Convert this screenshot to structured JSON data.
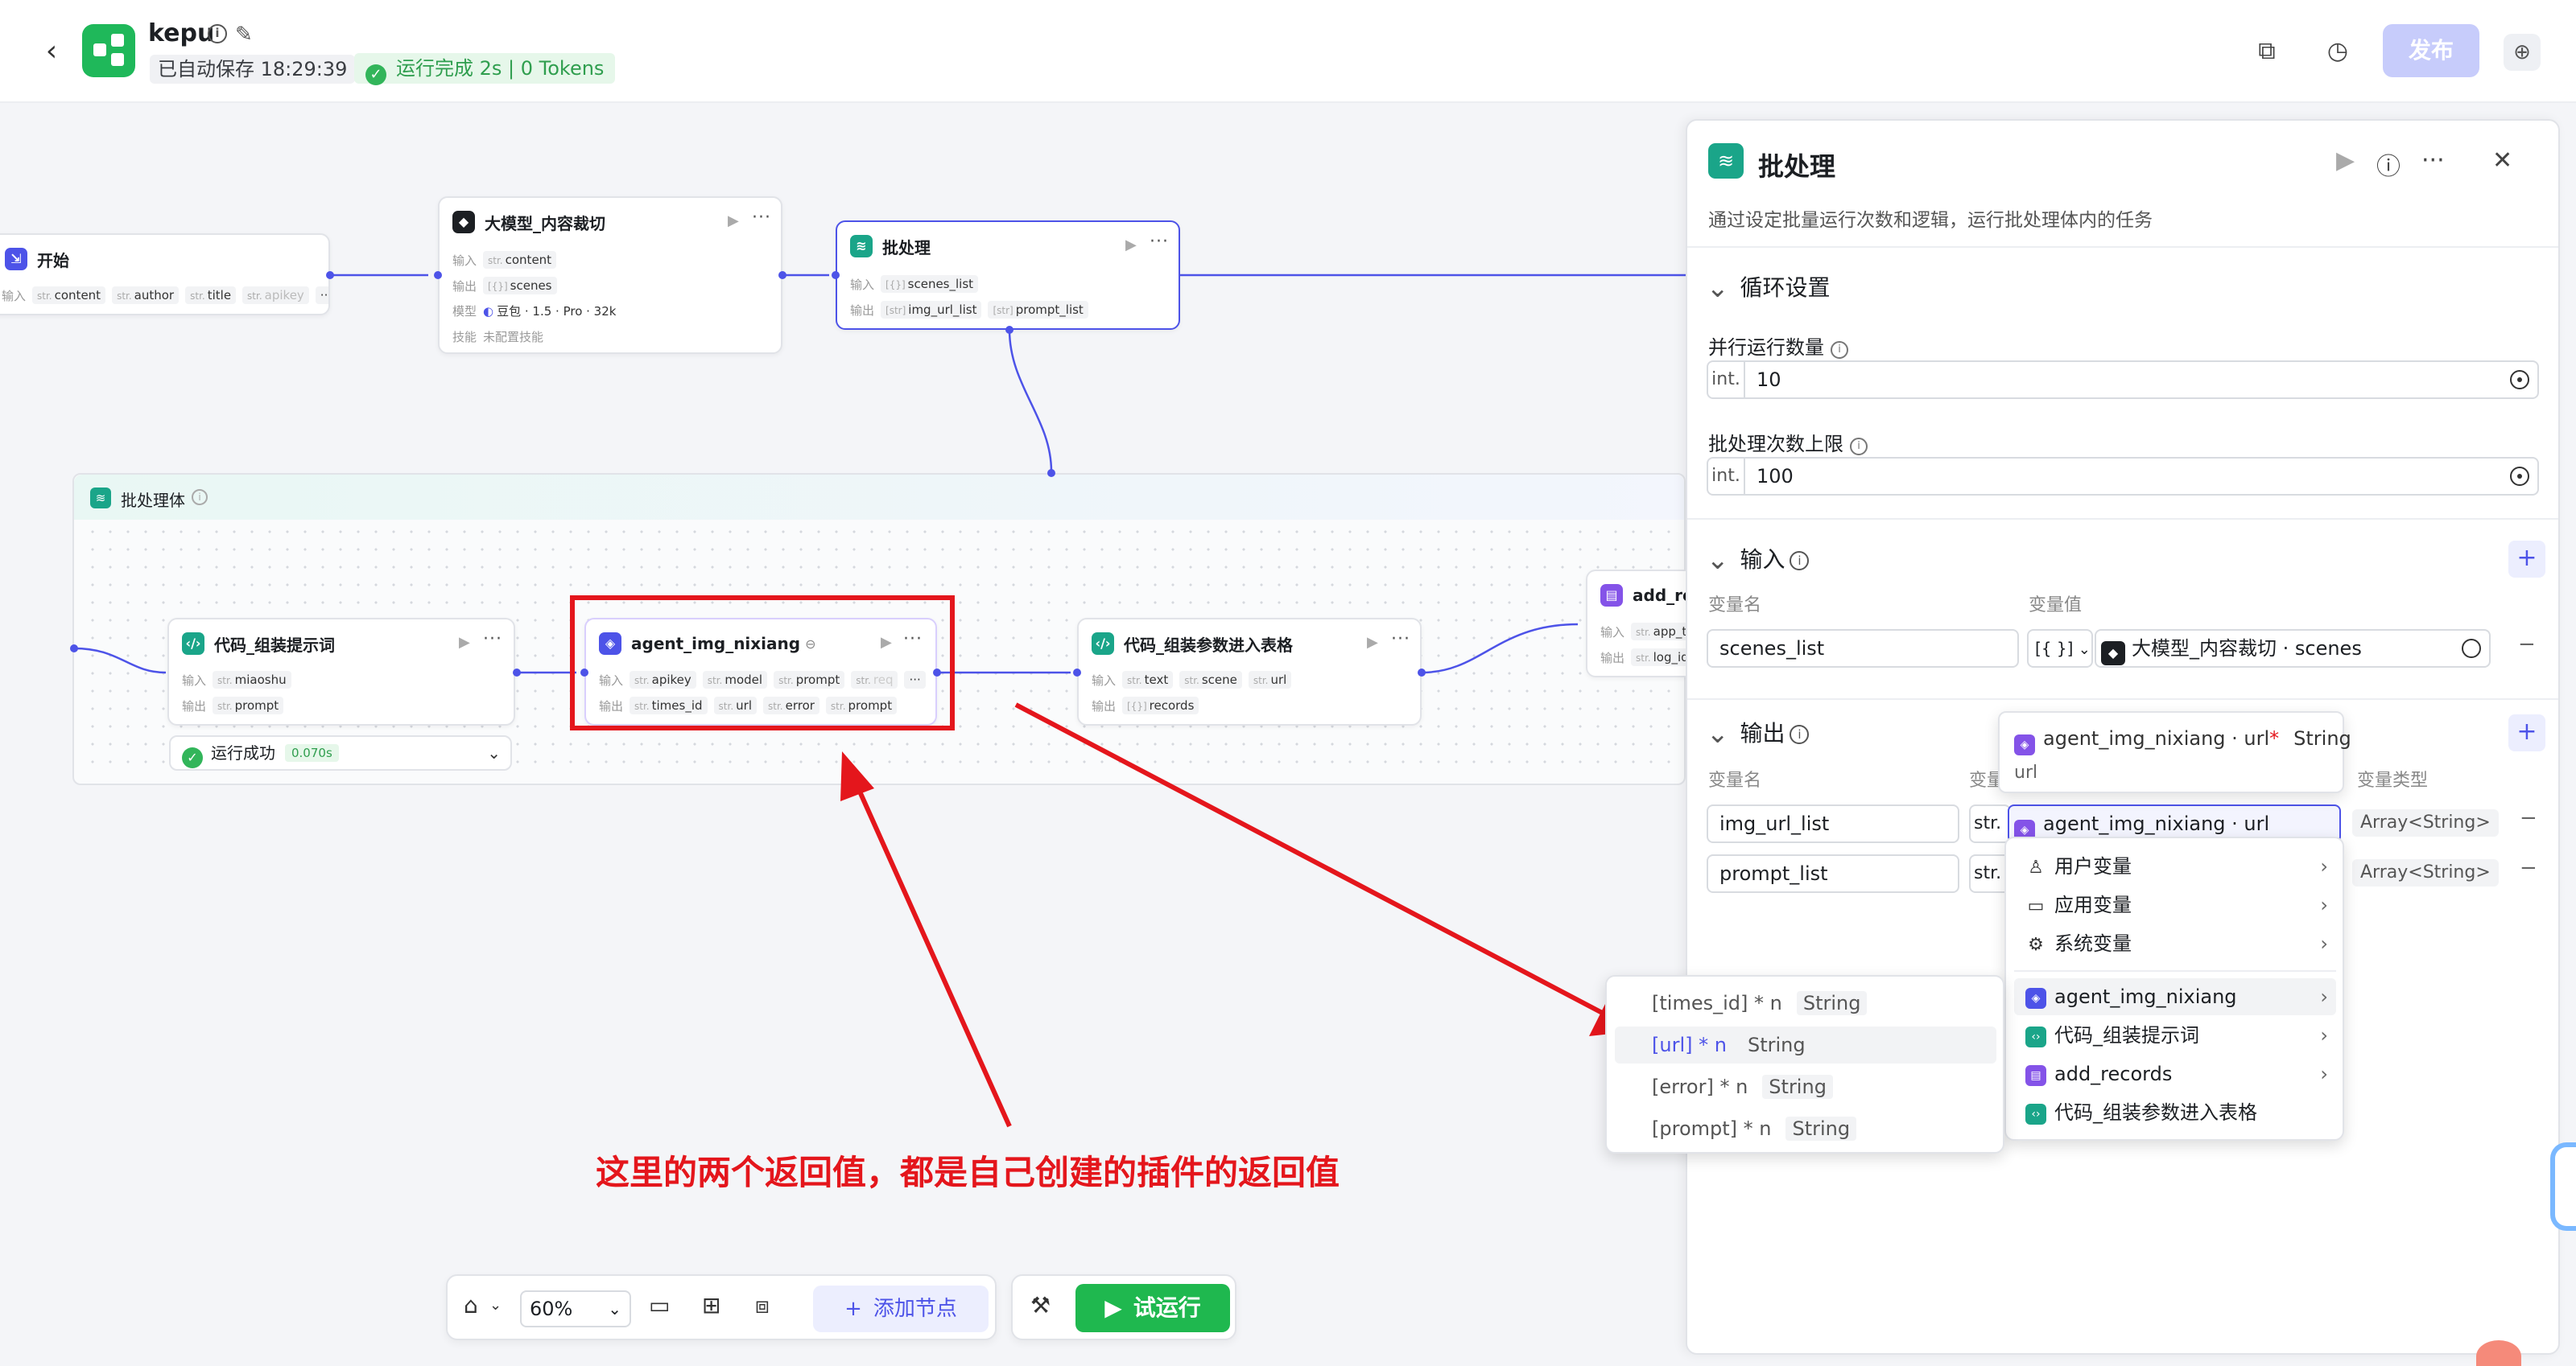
{
  "app": {
    "name": "kepu",
    "autosave": "已自动保存 18:29:39",
    "run_status": "运行完成 2s | 0 Tokens",
    "publish_label": "发布"
  },
  "nodes": {
    "start": {
      "title": "开始",
      "input_label": "输入",
      "fields": [
        "content",
        "author",
        "title",
        "apikey"
      ]
    },
    "llm": {
      "title": "大模型_内容裁切",
      "rows": [
        {
          "label": "输入",
          "tags": [
            "content"
          ]
        },
        {
          "label": "输出",
          "tags": [
            "scenes"
          ]
        },
        {
          "label": "模型",
          "text": "豆包 · 1.5 · Pro · 32k"
        },
        {
          "label": "技能",
          "text": "未配置技能"
        }
      ]
    },
    "batch": {
      "title": "批处理",
      "rows": [
        {
          "label": "输入",
          "tags": [
            "scenes_list"
          ]
        },
        {
          "label": "输出",
          "tags": [
            "img_url_list",
            "prompt_list"
          ]
        }
      ]
    },
    "batch_body": {
      "title": "批处理体"
    },
    "code_prompt": {
      "title": "代码_组装提示词",
      "rows": [
        {
          "label": "输入",
          "tags": [
            "miaoshu"
          ]
        },
        {
          "label": "输出",
          "tags": [
            "prompt"
          ]
        }
      ],
      "run_ok": "运行成功",
      "run_time": "0.070s"
    },
    "agent": {
      "title": "agent_img_nixiang",
      "rows": [
        {
          "label": "输入",
          "tags": [
            "apikey",
            "model",
            "prompt",
            "req"
          ]
        },
        {
          "label": "输出",
          "tags": [
            "times_id",
            "url",
            "error",
            "prompt"
          ]
        }
      ]
    },
    "code_table": {
      "title": "代码_组装参数进入表格",
      "rows": [
        {
          "label": "输入",
          "tags": [
            "text",
            "scene",
            "url"
          ]
        },
        {
          "label": "输出",
          "tags": [
            "records"
          ]
        }
      ]
    },
    "add_records": {
      "title": "add_re",
      "rows": [
        {
          "label": "输入",
          "tags": [
            "app_t"
          ]
        },
        {
          "label": "输出",
          "tags": [
            "log_id"
          ]
        }
      ]
    }
  },
  "annotation": "这里的两个返回值，都是自己创建的插件的返回值",
  "toolbar": {
    "zoom": "60%",
    "add_node": "添加节点",
    "try_run": "试运行"
  },
  "panel": {
    "title": "批处理",
    "desc": "通过设定批量运行次数和逻辑，运行批处理体内的任务",
    "loop_section": "循环设置",
    "parallel_label": "并行运行数量",
    "parallel_type": "int.",
    "parallel_value": "10",
    "limit_label": "批处理次数上限",
    "limit_type": "int.",
    "limit_value": "100",
    "input_section": "输入",
    "col_var_name": "变量名",
    "col_var_value": "变量值",
    "input_row": {
      "name": "scenes_list",
      "type": "[{ }]",
      "ref": "大模型_内容裁切 · scenes"
    },
    "output_section": "输出",
    "col_out_name": "变量名",
    "col_out_value": "变量",
    "col_out_type": "变量类型",
    "outputs": [
      {
        "name": "img_url_list",
        "type_short": "str.",
        "ref": "agent_img_nixiang · url",
        "var_type": "Array<String>"
      },
      {
        "name": "prompt_list",
        "type_short": "str.",
        "var_type": "Array<String>"
      }
    ]
  },
  "tooltip": {
    "line1": "agent_img_nixiang · url",
    "required": "*",
    "type": "String",
    "line2": "url"
  },
  "menu": {
    "items": [
      {
        "label": "用户变量"
      },
      {
        "label": "应用变量"
      },
      {
        "label": "系统变量"
      },
      {
        "label": "agent_img_nixiang"
      },
      {
        "label": "代码_组装提示词"
      },
      {
        "label": "add_records"
      },
      {
        "label": "代码_组装参数进入表格"
      }
    ]
  },
  "submenu": {
    "items": [
      {
        "label": "[times_id] * n",
        "type": "String"
      },
      {
        "label": "[url] * n",
        "type": "String"
      },
      {
        "label": "[error] * n",
        "type": "String"
      },
      {
        "label": "[prompt] * n",
        "type": "String"
      }
    ]
  }
}
